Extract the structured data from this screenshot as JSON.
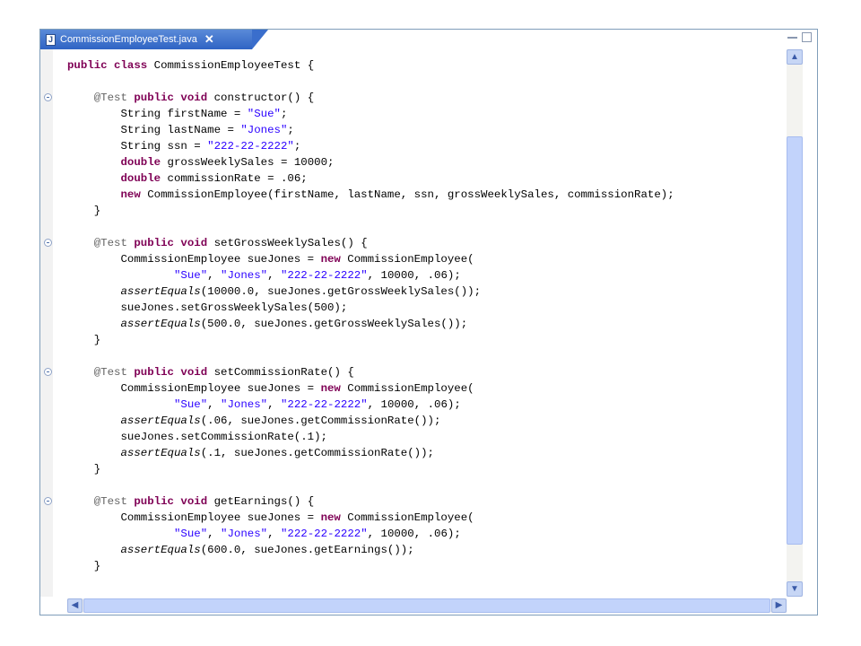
{
  "tab": {
    "title": "CommissionEmployeeTest.java",
    "close": "✕",
    "file_icon": "J"
  },
  "icons": {
    "file": "java-file-icon",
    "minimize": "minimize-icon",
    "maximize": "maximize-icon",
    "fold": "collapse-fold-icon",
    "up": "▲",
    "down": "▼",
    "left": "◀",
    "right": "▶"
  },
  "colors": {
    "keyword": "#7f0055",
    "string": "#2a00ff",
    "annotation": "#646464",
    "tab_active": "#3a6ecc",
    "scroll_thumb": "#c2d3fb"
  },
  "code": {
    "lines": [
      [
        {
          "t": "public class",
          "c": "kw"
        },
        {
          "t": " CommissionEmployeeTest {"
        }
      ],
      [],
      [
        {
          "t": "    "
        },
        {
          "t": "@Test",
          "c": "ann"
        },
        {
          "t": " "
        },
        {
          "t": "public void",
          "c": "kw"
        },
        {
          "t": " constructor() {"
        }
      ],
      [
        {
          "t": "        String firstName = "
        },
        {
          "t": "\"Sue\"",
          "c": "str"
        },
        {
          "t": ";"
        }
      ],
      [
        {
          "t": "        String lastName = "
        },
        {
          "t": "\"Jones\"",
          "c": "str"
        },
        {
          "t": ";"
        }
      ],
      [
        {
          "t": "        String ssn = "
        },
        {
          "t": "\"222-22-2222\"",
          "c": "str"
        },
        {
          "t": ";"
        }
      ],
      [
        {
          "t": "        "
        },
        {
          "t": "double",
          "c": "kw"
        },
        {
          "t": " grossWeeklySales = 10000;"
        }
      ],
      [
        {
          "t": "        "
        },
        {
          "t": "double",
          "c": "kw"
        },
        {
          "t": " commissionRate = .06;"
        }
      ],
      [
        {
          "t": "        "
        },
        {
          "t": "new",
          "c": "kw"
        },
        {
          "t": " CommissionEmployee(firstName, lastName, ssn, grossWeeklySales, commissionRate);"
        }
      ],
      [
        {
          "t": "    }"
        }
      ],
      [],
      [
        {
          "t": "    "
        },
        {
          "t": "@Test",
          "c": "ann"
        },
        {
          "t": " "
        },
        {
          "t": "public void",
          "c": "kw"
        },
        {
          "t": " setGrossWeeklySales() {"
        }
      ],
      [
        {
          "t": "        CommissionEmployee sueJones = "
        },
        {
          "t": "new",
          "c": "kw"
        },
        {
          "t": " CommissionEmployee("
        }
      ],
      [
        {
          "t": "                "
        },
        {
          "t": "\"Sue\"",
          "c": "str"
        },
        {
          "t": ", "
        },
        {
          "t": "\"Jones\"",
          "c": "str"
        },
        {
          "t": ", "
        },
        {
          "t": "\"222-22-2222\"",
          "c": "str"
        },
        {
          "t": ", 10000, .06);"
        }
      ],
      [
        {
          "t": "        "
        },
        {
          "t": "assertEquals",
          "c": "it"
        },
        {
          "t": "(10000.0, sueJones.getGrossWeeklySales());"
        }
      ],
      [
        {
          "t": "        sueJones.setGrossWeeklySales(500);"
        }
      ],
      [
        {
          "t": "        "
        },
        {
          "t": "assertEquals",
          "c": "it"
        },
        {
          "t": "(500.0, sueJones.getGrossWeeklySales());"
        }
      ],
      [
        {
          "t": "    }"
        }
      ],
      [],
      [
        {
          "t": "    "
        },
        {
          "t": "@Test",
          "c": "ann"
        },
        {
          "t": " "
        },
        {
          "t": "public void",
          "c": "kw"
        },
        {
          "t": " setCommissionRate() {"
        }
      ],
      [
        {
          "t": "        CommissionEmployee sueJones = "
        },
        {
          "t": "new",
          "c": "kw"
        },
        {
          "t": " CommissionEmployee("
        }
      ],
      [
        {
          "t": "                "
        },
        {
          "t": "\"Sue\"",
          "c": "str"
        },
        {
          "t": ", "
        },
        {
          "t": "\"Jones\"",
          "c": "str"
        },
        {
          "t": ", "
        },
        {
          "t": "\"222-22-2222\"",
          "c": "str"
        },
        {
          "t": ", 10000, .06);"
        }
      ],
      [
        {
          "t": "        "
        },
        {
          "t": "assertEquals",
          "c": "it"
        },
        {
          "t": "(.06, sueJones.getCommissionRate());"
        }
      ],
      [
        {
          "t": "        sueJones.setCommissionRate(.1);"
        }
      ],
      [
        {
          "t": "        "
        },
        {
          "t": "assertEquals",
          "c": "it"
        },
        {
          "t": "(.1, sueJones.getCommissionRate());"
        }
      ],
      [
        {
          "t": "    }"
        }
      ],
      [],
      [
        {
          "t": "    "
        },
        {
          "t": "@Test",
          "c": "ann"
        },
        {
          "t": " "
        },
        {
          "t": "public void",
          "c": "kw"
        },
        {
          "t": " getEarnings() {"
        }
      ],
      [
        {
          "t": "        CommissionEmployee sueJones = "
        },
        {
          "t": "new",
          "c": "kw"
        },
        {
          "t": " CommissionEmployee("
        }
      ],
      [
        {
          "t": "                "
        },
        {
          "t": "\"Sue\"",
          "c": "str"
        },
        {
          "t": ", "
        },
        {
          "t": "\"Jones\"",
          "c": "str"
        },
        {
          "t": ", "
        },
        {
          "t": "\"222-22-2222\"",
          "c": "str"
        },
        {
          "t": ", 10000, .06);"
        }
      ],
      [
        {
          "t": "        "
        },
        {
          "t": "assertEquals",
          "c": "it"
        },
        {
          "t": "(600.0, sueJones.getEarnings());"
        }
      ],
      [
        {
          "t": "    }"
        }
      ]
    ],
    "fold_lines": [
      2,
      11,
      19,
      27
    ]
  }
}
